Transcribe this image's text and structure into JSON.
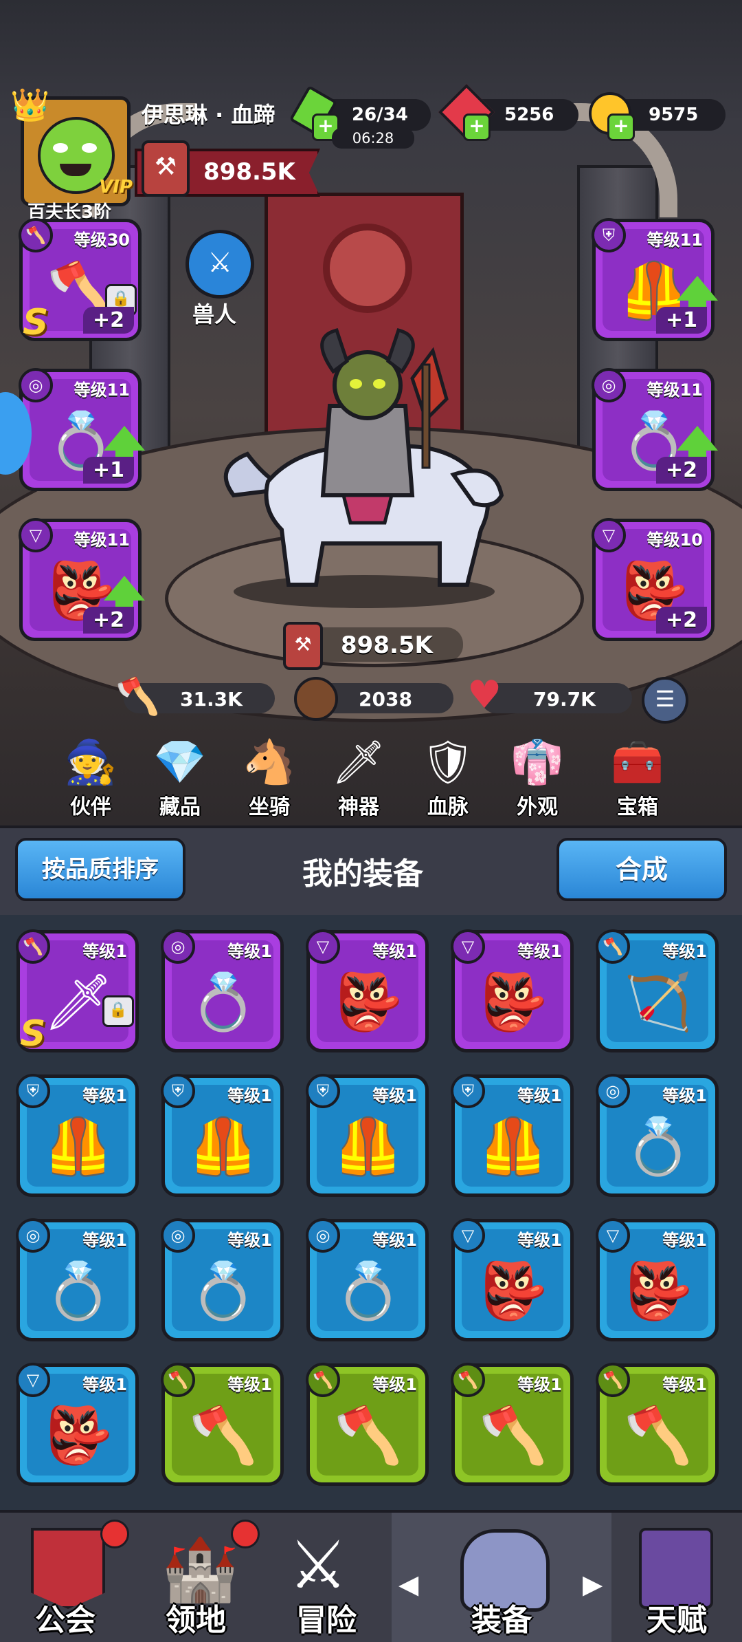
{
  "player": {
    "name": "伊思琳 · 血蹄",
    "rank": "百夫长3阶",
    "vip": "VIP",
    "power": "898.5K"
  },
  "resources": {
    "energy": "26/34",
    "energy_timer": "06:28",
    "gems": "5256",
    "gold": "9575"
  },
  "race": {
    "label": "兽人"
  },
  "hero_power": "898.5K",
  "stats": {
    "attack": "31.3K",
    "defense": "2038",
    "hp": "79.7K"
  },
  "equipped": {
    "left": [
      {
        "icon": "axe-icon",
        "level": "等级30",
        "plus": "+2",
        "rarity": "S",
        "locked": true,
        "upgrade": false
      },
      {
        "icon": "ring-icon",
        "level": "等级11",
        "plus": "+1",
        "upgrade": true
      },
      {
        "icon": "necklace-icon",
        "level": "等级11",
        "plus": "+2",
        "upgrade": true
      }
    ],
    "right": [
      {
        "icon": "armor-icon",
        "level": "等级11",
        "plus": "+1",
        "upgrade": true
      },
      {
        "icon": "ring-icon",
        "level": "等级11",
        "plus": "+2",
        "upgrade": true
      },
      {
        "icon": "necklace-icon",
        "level": "等级10",
        "plus": "+2",
        "upgrade": false
      }
    ]
  },
  "menu": [
    {
      "icon": "partner-icon",
      "label": "伙伴"
    },
    {
      "icon": "collection-icon",
      "label": "藏品"
    },
    {
      "icon": "mount-icon",
      "label": "坐骑"
    },
    {
      "icon": "artifact-icon",
      "label": "神器"
    },
    {
      "icon": "bloodline-icon",
      "label": "血脉"
    },
    {
      "icon": "appearance-icon",
      "label": "外观"
    },
    {
      "icon": "chest-icon",
      "label": "宝箱"
    }
  ],
  "inventory": {
    "sort_button": "按品质排序",
    "title": "我的装备",
    "merge_button": "合成",
    "items": [
      {
        "icon": "sword-icon",
        "slot": "weapon",
        "level": "等级1",
        "rarity": "purple",
        "s_rank": true,
        "locked": true
      },
      {
        "icon": "ring-icon",
        "slot": "ring",
        "level": "等级1",
        "rarity": "purple"
      },
      {
        "icon": "necklace-icon",
        "slot": "necklace",
        "level": "等级1",
        "rarity": "purple"
      },
      {
        "icon": "necklace-icon",
        "slot": "necklace",
        "level": "等级1",
        "rarity": "purple"
      },
      {
        "icon": "bow-icon",
        "slot": "weapon",
        "level": "等级1",
        "rarity": "blue"
      },
      {
        "icon": "armor-icon",
        "slot": "armor",
        "level": "等级1",
        "rarity": "blue"
      },
      {
        "icon": "armor-icon",
        "slot": "armor",
        "level": "等级1",
        "rarity": "blue"
      },
      {
        "icon": "armor-icon",
        "slot": "armor",
        "level": "等级1",
        "rarity": "blue"
      },
      {
        "icon": "armor-icon",
        "slot": "armor",
        "level": "等级1",
        "rarity": "blue"
      },
      {
        "icon": "ring-icon",
        "slot": "ring",
        "level": "等级1",
        "rarity": "blue"
      },
      {
        "icon": "ring-icon",
        "slot": "ring",
        "level": "等级1",
        "rarity": "blue"
      },
      {
        "icon": "ring-icon",
        "slot": "ring",
        "level": "等级1",
        "rarity": "blue"
      },
      {
        "icon": "ring-icon",
        "slot": "ring",
        "level": "等级1",
        "rarity": "blue"
      },
      {
        "icon": "necklace-icon",
        "slot": "necklace",
        "level": "等级1",
        "rarity": "blue"
      },
      {
        "icon": "necklace-icon",
        "slot": "necklace",
        "level": "等级1",
        "rarity": "blue"
      },
      {
        "icon": "necklace-icon",
        "slot": "necklace",
        "level": "等级1",
        "rarity": "blue"
      },
      {
        "icon": "axe-icon",
        "slot": "weapon",
        "level": "等级1",
        "rarity": "green"
      },
      {
        "icon": "axe-icon",
        "slot": "weapon",
        "level": "等级1",
        "rarity": "green"
      },
      {
        "icon": "axe-icon",
        "slot": "weapon",
        "level": "等级1",
        "rarity": "green"
      },
      {
        "icon": "axe-icon",
        "slot": "weapon",
        "level": "等级1",
        "rarity": "green"
      }
    ]
  },
  "bottom_nav": [
    {
      "icon": "guild-icon",
      "label": "公会",
      "dot": true
    },
    {
      "icon": "territory-icon",
      "label": "领地",
      "dot": true
    },
    {
      "icon": "adventure-icon",
      "label": "冒险",
      "dot": false
    },
    {
      "icon": "equipment-icon",
      "label": "装备",
      "dot": false,
      "active": true
    },
    {
      "icon": "talent-icon",
      "label": "天赋",
      "dot": false
    }
  ],
  "colors": {
    "purple": "#a93ee0",
    "blue": "#2aa6e0",
    "green": "#8ec526",
    "plus_green": "#5fd13a",
    "gem_red": "#e33a4a",
    "gold": "#ffc52a"
  }
}
